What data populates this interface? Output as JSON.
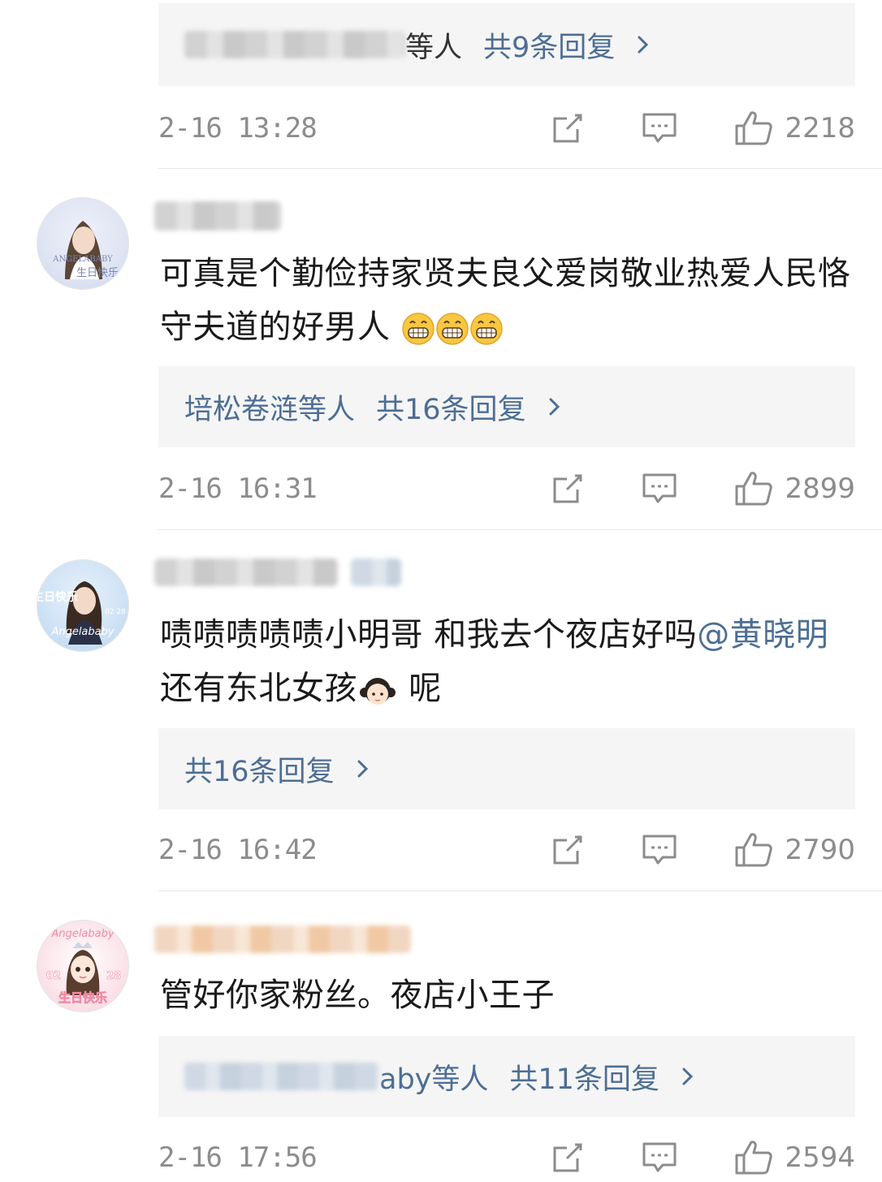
{
  "comments": [
    {
      "id": "c0",
      "reply_names": "等人",
      "reply_count": "共9条回复",
      "time": "2-16 13:28",
      "likes": "2218"
    },
    {
      "id": "c1",
      "avatar_caption": "生日快乐",
      "avatar_text": "ANGELABABY",
      "text": "可真是个勤俭持家贤夫良父爱岗敬业热爱人民恪守夫道的好男人",
      "emojis": [
        "grin-emoji",
        "grin-emoji",
        "grin-emoji"
      ],
      "reply_names": "培松卷涟等人",
      "reply_count": "共16条回复",
      "time": "2-16 16:31",
      "likes": "2899"
    },
    {
      "id": "c2",
      "avatar_caption": "生日快乐",
      "avatar_text": "Angelababy",
      "avatar_date": "02 28",
      "text_a": "啧啧啧啧啧小明哥 和我去个夜店好吗",
      "mention": "@黄晓明",
      "text_b": " 还有东北女孩",
      "text_c": " 呢",
      "reply_count": "共16条回复",
      "time": "2-16 16:42",
      "likes": "2790"
    },
    {
      "id": "c3",
      "avatar_caption": "生日快乐",
      "avatar_text": "Angelababy",
      "avatar_date_left": "02",
      "avatar_date_right": "28",
      "text": "管好你家粉丝。夜店小王子",
      "reply_names": "aby等人",
      "reply_count": "共11条回复",
      "time": "2-16 17:56",
      "likes": "2594"
    }
  ],
  "icons": {
    "share": "share-icon",
    "comment": "comment-icon",
    "like": "thumbs-up-icon",
    "chevron": "chevron-right-icon"
  },
  "colors": {
    "link": "#4d6e95",
    "meta": "#8c8c8c",
    "reply_bg": "#f5f5f5"
  }
}
